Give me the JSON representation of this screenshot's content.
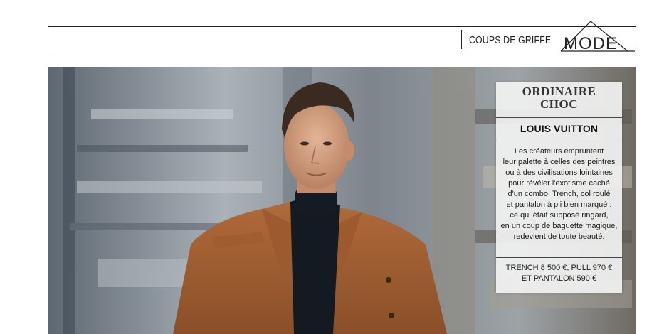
{
  "header": {
    "section_label": "COUPS DE GRIFFE",
    "logo_text": "MODE"
  },
  "photo": {
    "description_icon": "photo-image"
  },
  "sidebar": {
    "headline_line1": "ORDINAIRE",
    "headline_line2": "CHOC",
    "brand": "LOUIS VUITTON",
    "body_lines": [
      "Les créateurs empruntent",
      "leur palette à celles des peintres",
      "ou à des civilisations lointaines",
      "pour révéler l'exotisme caché",
      "d'un combo. Trench, col roulé",
      "et pantalon à pli bien marqué :",
      "ce qui était supposé ringard,",
      "en un coup de baguette magique,",
      "redevient de toute beauté."
    ],
    "price_lines": [
      "TRENCH 8 500 €, PULL 970 €",
      "ET PANTALON 590 €"
    ]
  }
}
